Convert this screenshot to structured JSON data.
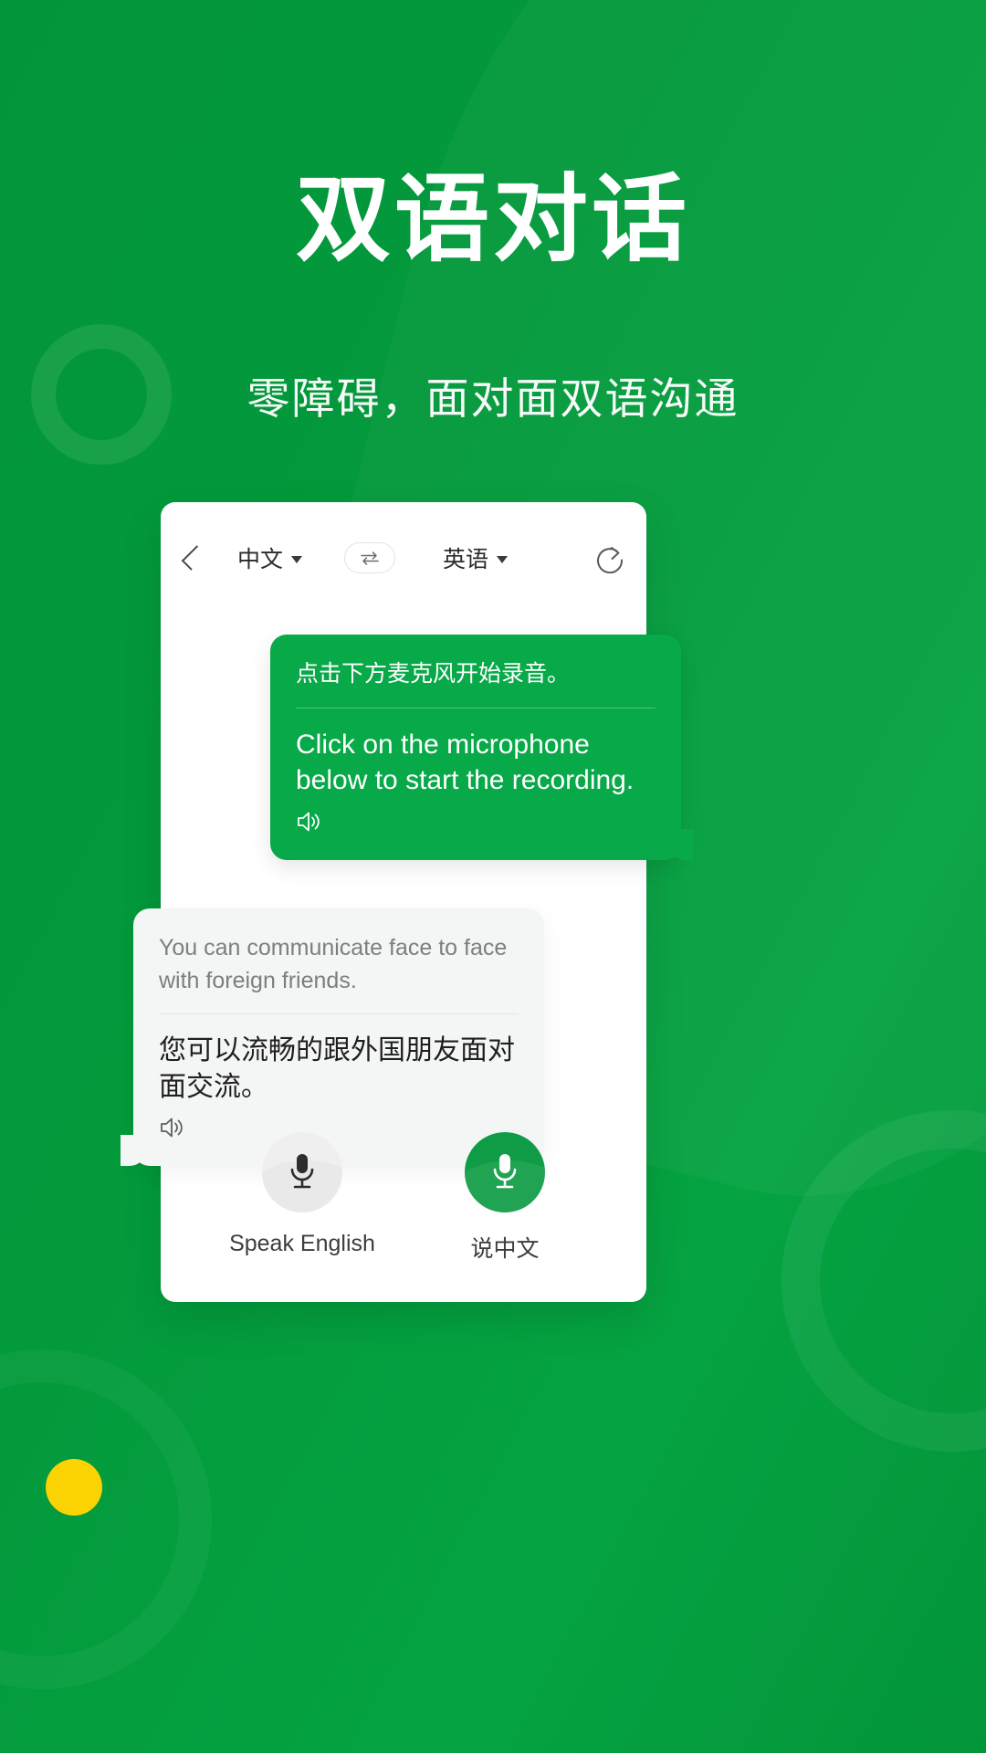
{
  "promo": {
    "title": "双语对话",
    "subtitle": "零障碍，面对面双语沟通",
    "accent_color": "#18e86a",
    "background_color": "#049a3c",
    "dot_color": "#fbd202"
  },
  "app": {
    "header": {
      "back_icon": "chevron-left-icon",
      "source_language": "中文",
      "target_language": "英语",
      "swap_icon": "swap-arrows-icon",
      "share_icon": "share-icon",
      "caret_icon": "chevron-down-icon"
    },
    "messages": [
      {
        "side": "right",
        "source_text": "点击下方麦克风开始录音。",
        "translated_text": "Click on the microphone below to start the recording.",
        "speaker_icon": "speaker-icon"
      },
      {
        "side": "left",
        "source_text": "You can communicate face to face with foreign friends.",
        "translated_text": "您可以流畅的跟外国朋友面对面交流。",
        "speaker_icon": "speaker-icon"
      }
    ],
    "controls": [
      {
        "label": "Speak English",
        "icon": "microphone-icon",
        "state": "inactive",
        "color": "#efefef"
      },
      {
        "label": "说中文",
        "icon": "microphone-icon",
        "state": "active",
        "color": "#109c46"
      }
    ]
  }
}
